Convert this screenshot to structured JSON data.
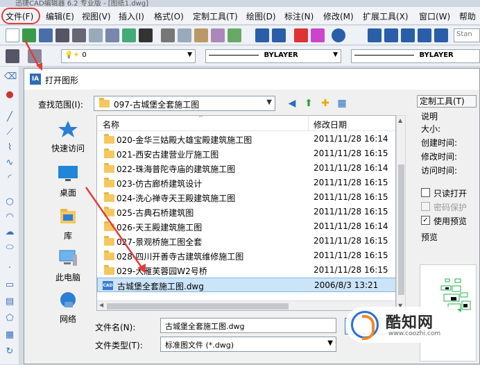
{
  "app": {
    "title": "迅捷CAD编辑器 6.2 专业版 - [图纸1.dwg]"
  },
  "menu": {
    "items": [
      "文件(F)",
      "编辑(E)",
      "视图(V)",
      "插入(I)",
      "格式(O)",
      "定制工具(T)",
      "绘图(D)",
      "标注(N)",
      "修改(M)",
      "扩展工具(X)",
      "窗口(W)",
      "帮助"
    ]
  },
  "toolbar": {
    "layer_value": "0",
    "linetype_value": "BYLAYER",
    "lineweight_value": "BYLAYER",
    "style_value": "Stan"
  },
  "dialog": {
    "title": "打开图形",
    "look_in_label": "查找范围(I):",
    "look_in_value": "097-古城堡全套施工图",
    "places": [
      {
        "label": "快速访问",
        "icon": "star-icon"
      },
      {
        "label": "桌面",
        "icon": "desktop-icon"
      },
      {
        "label": "库",
        "icon": "library-icon"
      },
      {
        "label": "此电脑",
        "icon": "computer-icon"
      },
      {
        "label": "网络",
        "icon": "network-icon"
      }
    ],
    "columns": {
      "name": "名称",
      "date": "修改日期"
    },
    "files": [
      {
        "name": "020-金华三姑殿大雄宝殿建筑施工图",
        "date": "2011/11/28 16:14",
        "type": "folder"
      },
      {
        "name": "021-西安古建营业厅施工图",
        "date": "2011/11/28 16:15",
        "type": "folder"
      },
      {
        "name": "022-珠海普陀寺庙的建筑施工图",
        "date": "2011/11/28 16:14",
        "type": "folder"
      },
      {
        "name": "023-仿古廊桥建筑设计",
        "date": "2011/11/28 16:15",
        "type": "folder"
      },
      {
        "name": "024-洗心禅寺天王殿建筑施工图",
        "date": "2011/11/28 16:15",
        "type": "folder"
      },
      {
        "name": "025-古典石桥建筑图",
        "date": "2011/11/28 16:15",
        "type": "folder"
      },
      {
        "name": "026-天王殿建筑施工图",
        "date": "2011/11/28 16:14",
        "type": "folder"
      },
      {
        "name": "027-景观桥施工图全套",
        "date": "2011/11/28 16:15",
        "type": "folder"
      },
      {
        "name": "028-四川开善寺古建筑维修施工图",
        "date": "2011/11/28 16:15",
        "type": "folder"
      },
      {
        "name": "029-大雁芙蓉园W2号桥",
        "date": "2011/11/28 16:15",
        "type": "folder"
      },
      {
        "name": "古城堡全套施工图.dwg",
        "date": "2006/8/3 13:21",
        "type": "dwg"
      }
    ],
    "filename_label": "文件名(N):",
    "filename_value": "古城堡全套施工图.dwg",
    "filetype_label": "文件类型(T):",
    "filetype_value": "标准图文件 (*.dwg)",
    "custom_tools_label": "定制工具(T)",
    "info": {
      "title": "说明",
      "size_label": "大小:",
      "created_label": "创建时间:",
      "modified_label": "修改时间:",
      "accessed_label": "访问时间:"
    },
    "readonly_label": "只读打开",
    "password_label": "密码保护",
    "use_preview_label": "使用预览",
    "use_preview_checked": true,
    "preview_label": "预览"
  },
  "watermark": {
    "title": "酷知网",
    "url": "www.coozhi.com"
  },
  "colors": {
    "highlight_red": "#e23b3b",
    "selection": "#cce4f7",
    "folder": "#f4c760",
    "accent_blue": "#2e6db4"
  }
}
